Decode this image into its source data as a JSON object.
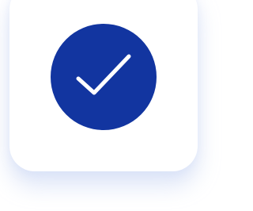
{
  "colors": {
    "background": "#ffffff",
    "card": "#ffffff",
    "badge": "#1235a0",
    "check": "#ffffff"
  },
  "icons": {
    "status": "checkmark-icon"
  }
}
